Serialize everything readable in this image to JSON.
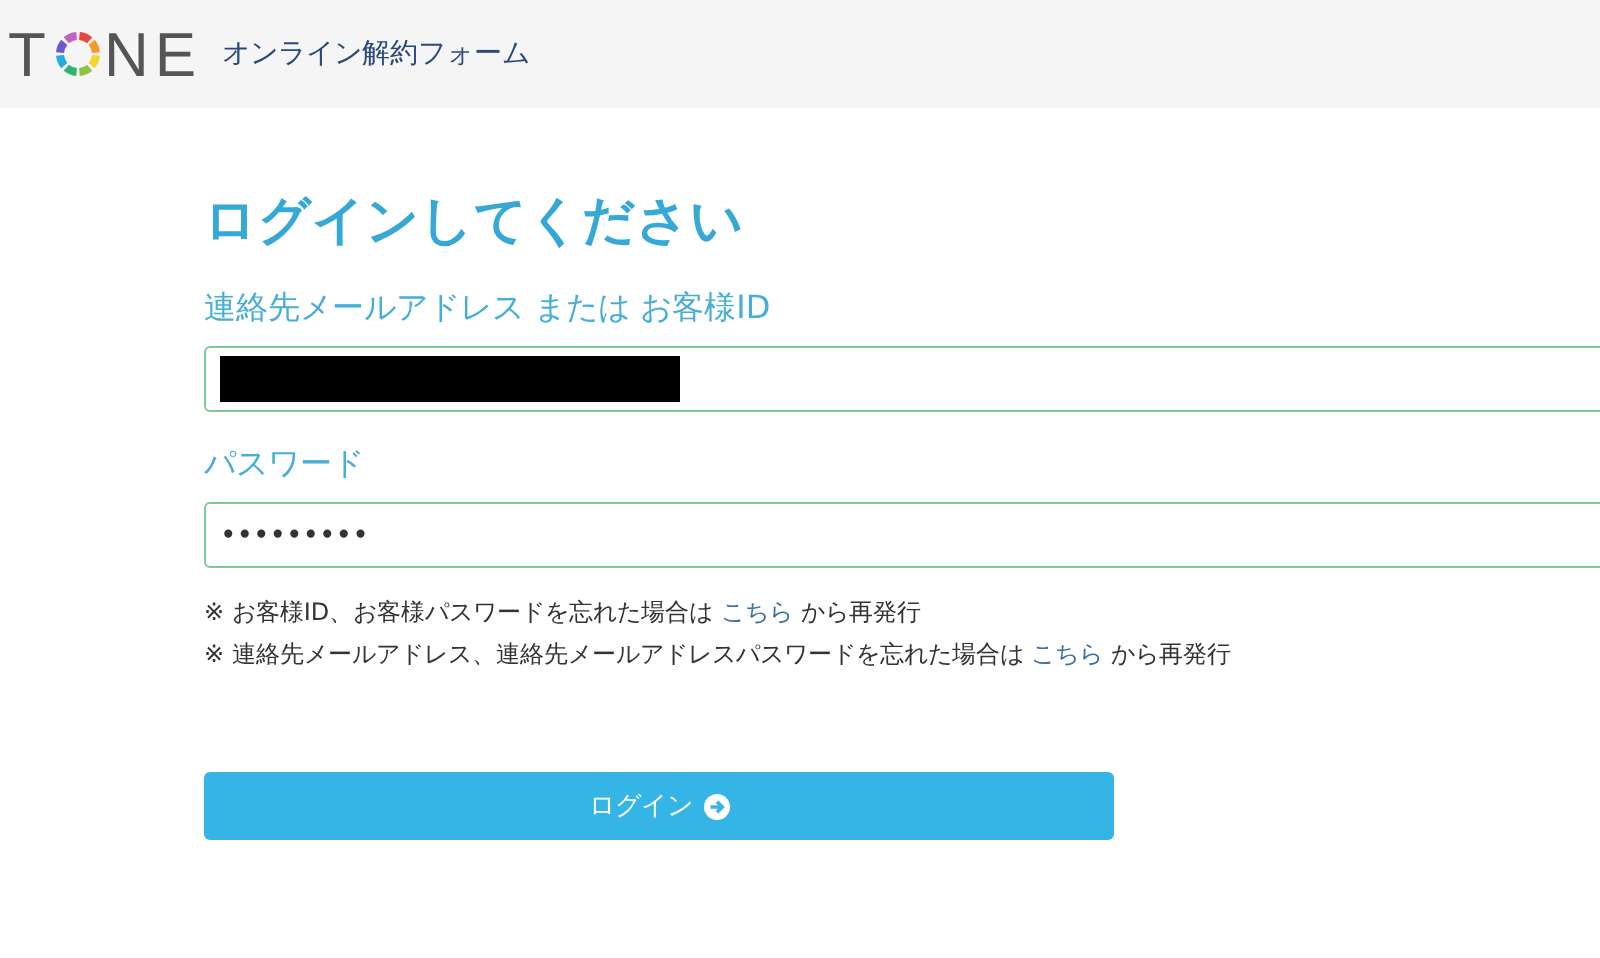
{
  "header": {
    "logo": {
      "before": "T",
      "after": "NE"
    },
    "subtitle": "オンライン解約フォーム"
  },
  "title": "ログインしてください",
  "fields": [
    {
      "label": "連絡先メールアドレス または お客様ID",
      "kind": "redacted"
    },
    {
      "label": "パスワード",
      "kind": "password",
      "value": "•••••••••"
    }
  ],
  "notes": [
    {
      "before": "※ お客様ID、お客様パスワードを忘れた場合は",
      "link": "こちら",
      "after": "から再発行"
    },
    {
      "before": "※ 連絡先メールアドレス、連絡先メールアドレスパスワードを忘れた場合は",
      "link": "こちら",
      "after": "から再発行"
    }
  ],
  "button": {
    "label": "ログイン"
  }
}
